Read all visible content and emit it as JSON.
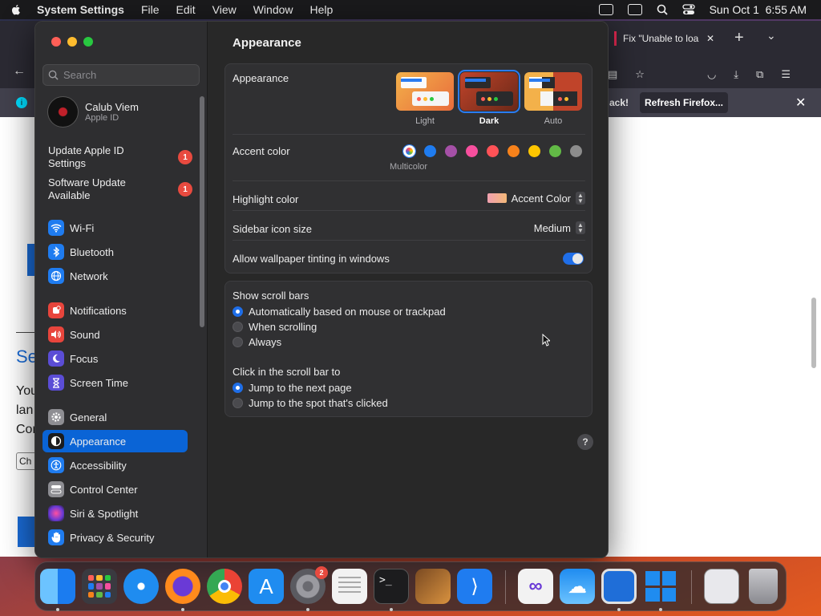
{
  "menubar": {
    "app_name": "System Settings",
    "menus": [
      "File",
      "Edit",
      "View",
      "Window",
      "Help"
    ],
    "datetime": "Sun Oct 1  6:55 AM"
  },
  "firefox": {
    "tab_title": "Fix \"Unable to loa",
    "notice_text": "ack!",
    "refresh_button": "Refresh Firefox...",
    "page_fragments": {
      "heading": "Se",
      "para1": "You",
      "para2": "lan",
      "para3": "Cor",
      "button_fragment": "Ch"
    }
  },
  "sidebar": {
    "search_placeholder": "Search",
    "profile": {
      "name": "Calub Viem",
      "subtitle": "Apple ID"
    },
    "notices": [
      {
        "label": "Update Apple ID Settings",
        "badge": "1"
      },
      {
        "label": "Software Update Available",
        "badge": "1"
      }
    ],
    "items": [
      {
        "label": "Wi-Fi",
        "color": "#1f7cf0",
        "icon": "wifi-icon"
      },
      {
        "label": "Bluetooth",
        "color": "#1f7cf0",
        "icon": "bluetooth-icon"
      },
      {
        "label": "Network",
        "color": "#1f7cf0",
        "icon": "globe-icon"
      },
      {
        "label": "Notifications",
        "color": "#e8453c",
        "icon": "bell-icon"
      },
      {
        "label": "Sound",
        "color": "#e8453c",
        "icon": "speaker-icon"
      },
      {
        "label": "Focus",
        "color": "#5b4dd6",
        "icon": "moon-icon"
      },
      {
        "label": "Screen Time",
        "color": "#5b4dd6",
        "icon": "hourglass-icon"
      },
      {
        "label": "General",
        "color": "#8e8e93",
        "icon": "gear-icon"
      },
      {
        "label": "Appearance",
        "color": "#1c1c1e",
        "icon": "appearance-icon"
      },
      {
        "label": "Accessibility",
        "color": "#1f7cf0",
        "icon": "accessibility-icon"
      },
      {
        "label": "Control Center",
        "color": "#8e8e93",
        "icon": "control-center-icon"
      },
      {
        "label": "Siri & Spotlight",
        "color": "#b04ad6",
        "icon": "siri-icon"
      },
      {
        "label": "Privacy & Security",
        "color": "#1f7cf0",
        "icon": "hand-icon"
      }
    ],
    "selected": "Appearance"
  },
  "main": {
    "title": "Appearance",
    "appearance": {
      "label": "Appearance",
      "options": [
        "Light",
        "Dark",
        "Auto"
      ],
      "selected": "Dark"
    },
    "accent": {
      "label": "Accent color",
      "caption": "Multicolor",
      "colors": [
        "#ffffff",
        "#1f7cf0",
        "#a550a7",
        "#f74f9e",
        "#ff5257",
        "#f7821b",
        "#ffc600",
        "#62ba46",
        "#8c8c8c"
      ]
    },
    "highlight": {
      "label": "Highlight color",
      "value": "Accent Color"
    },
    "sidebar_icon_size": {
      "label": "Sidebar icon size",
      "value": "Medium"
    },
    "wallpaper_tinting": {
      "label": "Allow wallpaper tinting in windows",
      "on": true
    },
    "scroll_bars": {
      "label": "Show scroll bars",
      "options": [
        "Automatically based on mouse or trackpad",
        "When scrolling",
        "Always"
      ],
      "selected": 0
    },
    "click_scroll": {
      "label": "Click in the scroll bar to",
      "options": [
        "Jump to the next page",
        "Jump to the spot that's clicked"
      ],
      "selected": 0
    },
    "help": "?"
  },
  "dock": {
    "settings_badge": "2"
  }
}
